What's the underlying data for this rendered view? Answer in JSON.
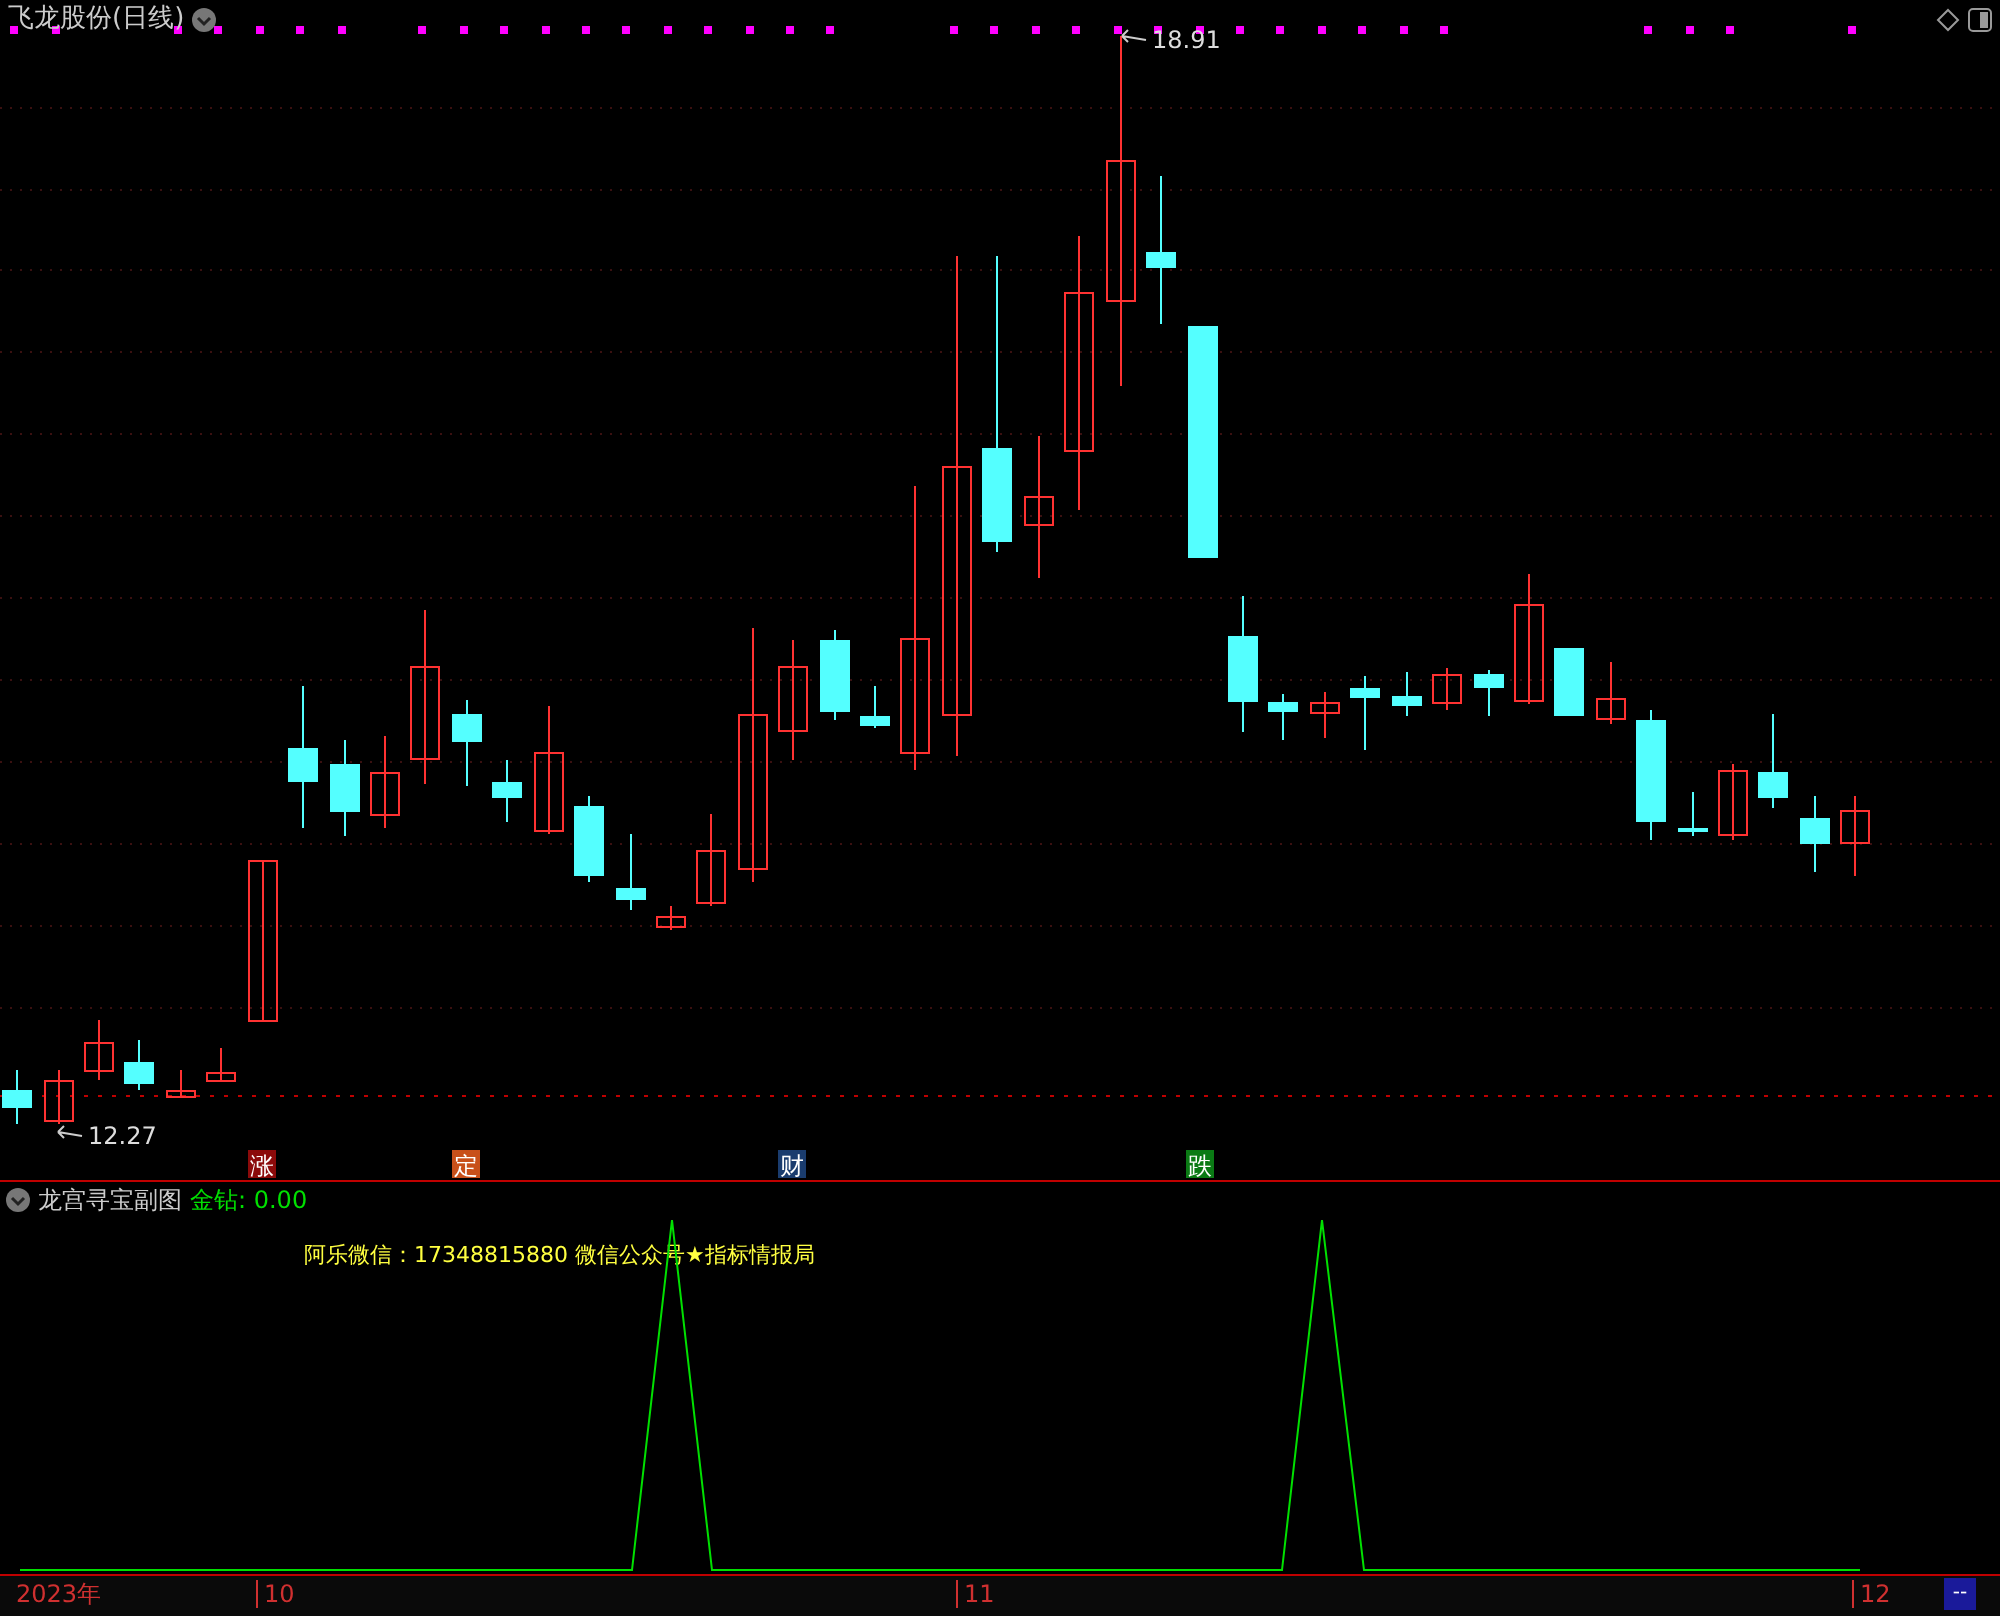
{
  "window": {
    "title": "飞龙股份(日线)"
  },
  "price_chart": {
    "high_label": "18.91",
    "low_label": "12.27"
  },
  "signals": [
    {
      "text": "涨",
      "color": "#8b0a0a"
    },
    {
      "text": "定",
      "color": "#c8501a"
    },
    {
      "text": "财",
      "color": "#1a3c6e"
    },
    {
      "text": "跌",
      "color": "#0a7a14"
    }
  ],
  "indicator": {
    "name": "龙宫寻宝副图",
    "reading": "金钻: 0.00",
    "note": "阿乐微信：17348815880 微信公众号★指标情报局"
  },
  "time_axis": {
    "labels": [
      "2023年",
      "10",
      "11",
      "12"
    ],
    "end_button": "--"
  }
}
